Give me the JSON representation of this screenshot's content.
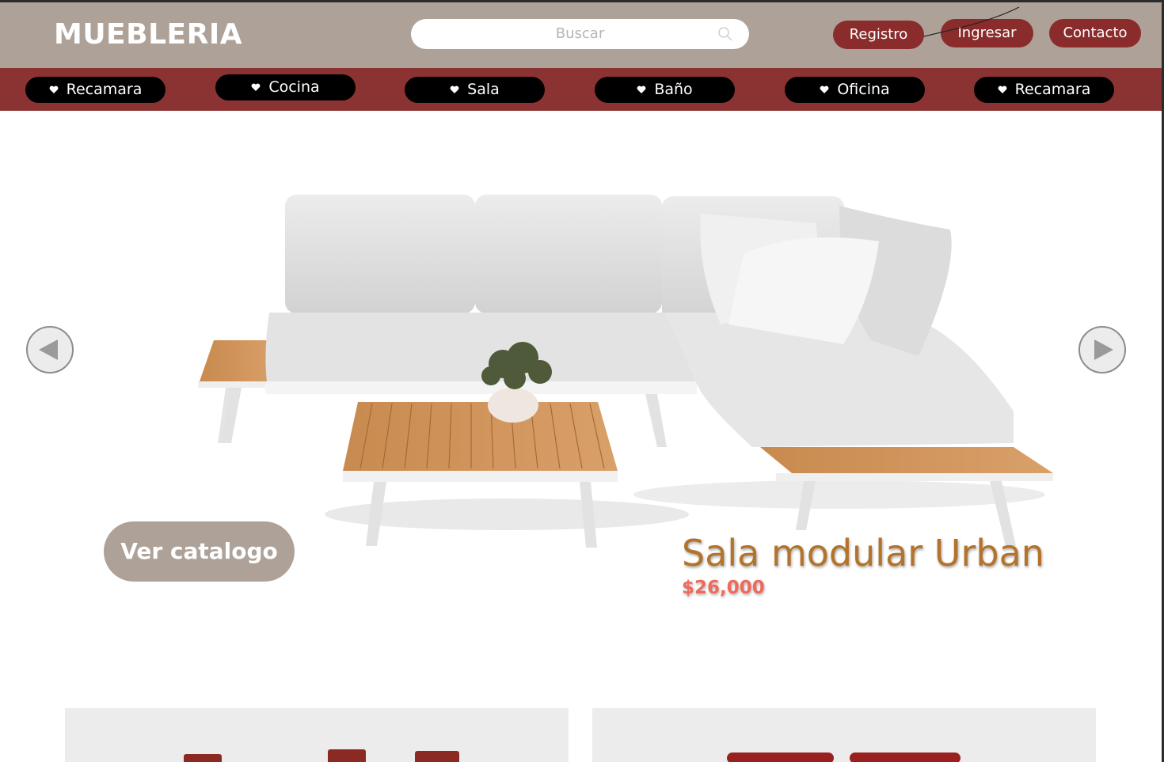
{
  "header": {
    "logo": "MUEBLERIA",
    "search_placeholder": "Buscar",
    "buttons": {
      "registro": "Registro",
      "ingresar": "Ingresar",
      "contacto": "Contacto"
    }
  },
  "categories": [
    "Recamara",
    "Cocina",
    "Sala",
    "Baño",
    "Oficina",
    "Recamara"
  ],
  "hero": {
    "catalog_button": "Ver catalogo",
    "product_name": "Sala modular Urban",
    "product_price": "$26,000"
  },
  "icons": {
    "search": "search-icon",
    "category": "heart-icon",
    "prev": "arrow-left-icon",
    "next": "arrow-right-icon"
  },
  "colors": {
    "header_bg": "#ada198",
    "category_bar_bg": "#8b3232",
    "pill_bg": "#8b2c2c",
    "product_name": "#b3732a",
    "product_price": "#f06a5c"
  }
}
